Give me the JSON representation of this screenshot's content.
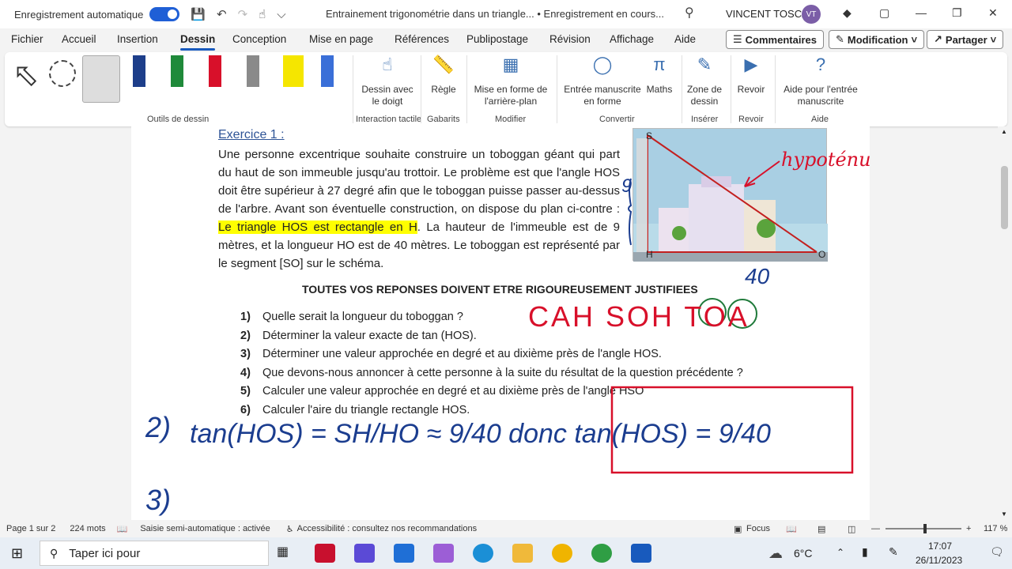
{
  "titlebar": {
    "autosave": "Enregistrement automatique",
    "doc_title": "Entrainement trigonométrie dans un triangle... • Enregistrement en cours...",
    "user": "VINCENT TOSCA",
    "initials": "VT"
  },
  "tabs": [
    "Fichier",
    "Accueil",
    "Insertion",
    "Dessin",
    "Conception",
    "Mise en page",
    "Références",
    "Publipostage",
    "Révision",
    "Affichage",
    "Aide"
  ],
  "tab_buttons": {
    "comments": "Commentaires",
    "mode": "Modification",
    "share": "Partager"
  },
  "ribbon": {
    "buttons": {
      "finger": "Dessin avec le doigt",
      "ruler": "Règle",
      "background": "Mise en forme de l'arrière-plan",
      "ink_shape": "Entrée manuscrite en forme",
      "math": "Maths",
      "zone": "Zone de dessin",
      "replay": "Revoir",
      "help": "Aide pour l'entrée manuscrite"
    },
    "groups": {
      "tools": "Outils de dessin",
      "touch": "Interaction tactile",
      "stencils": "Gabarits",
      "modify": "Modifier",
      "convert": "Convertir",
      "insert": "Insérer",
      "replay": "Revoir",
      "help": "Aide"
    }
  },
  "document": {
    "exercise_title": "Exercice 1 :",
    "para_a": "Une personne excentrique souhaite construire un toboggan géant qui part du haut de son immeuble jusqu'au trottoir. Le problème est que l'angle HOS doit être supérieur à 27 degré afin que le toboggan puisse passer au-dessus de l'arbre. Avant son éventuelle construction, on dispose du plan ci-contre : ",
    "para_hl": "Le triangle HOS est rectangle en H",
    "para_b": ". La hauteur de l'immeuble est de 9 mètres, et la longueur HO est de 40 mètres. Le toboggan est représenté par le segment [SO] sur le schéma.",
    "header": "TOUTES VOS REPONSES DOIVENT ETRE RIGOUREUSEMENT JUSTIFIEES",
    "questions": [
      {
        "n": "1)",
        "t": "Quelle serait la longueur du toboggan ?"
      },
      {
        "n": "2)",
        "t": "Déterminer la valeur exacte de tan (HOS)."
      },
      {
        "n": "3)",
        "t": "Déterminer une valeur approchée en degré et au dixième près de l'angle HOS."
      },
      {
        "n": "4)",
        "t": "Que devons-nous annoncer à cette personne à la suite du résultat de la question précédente ?"
      },
      {
        "n": "5)",
        "t": "Calculer une valeur approchée en degré et au dixième près de l'angle HSO"
      },
      {
        "n": "6)",
        "t": "Calculer l'aire du triangle rectangle HOS."
      }
    ],
    "fig_labels": {
      "s": "S",
      "h": "H",
      "o": "O"
    },
    "ink": {
      "hyp": "hypoténuse",
      "forty": "40",
      "nine": "9",
      "cah": "CAH SOH TOA",
      "n2": "2)",
      "n3": "3)",
      "eq1": "tan(HOS) = SH/HO ≈ 9/40 donc tan(HOS) = 9/40"
    }
  },
  "status": {
    "page": "Page 1 sur 2",
    "words": "224 mots",
    "predict": "Saisie semi-automatique : activée",
    "access": "Accessibilité : consultez nos recommandations",
    "focus": "Focus",
    "zoom": "117 %"
  },
  "taskbar": {
    "search": "Taper ici pour",
    "temp": "6°C",
    "time": "17:07",
    "date": "26/11/2023"
  },
  "colors": {
    "accent": "#185abd",
    "ink_blue": "#1b3d8f",
    "ink_red": "#d8102a",
    "ink_green": "#1f7a3a"
  }
}
